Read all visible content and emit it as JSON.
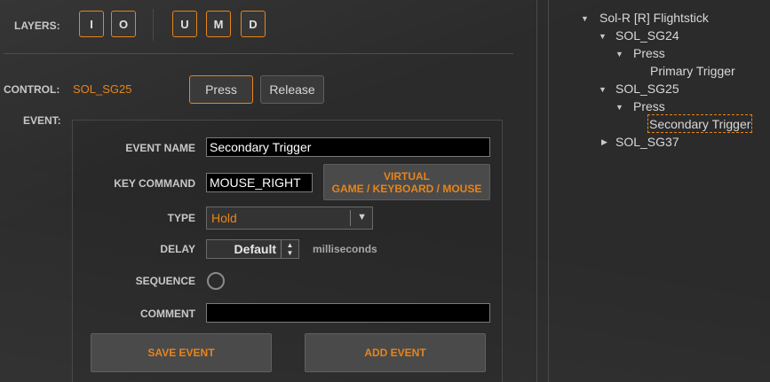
{
  "layers": {
    "label": "LAYERS:",
    "buttons": [
      "I",
      "O",
      "U",
      "M",
      "D"
    ]
  },
  "control": {
    "label": "CONTROL:",
    "value": "SOL_SG25",
    "press_label": "Press",
    "release_label": "Release"
  },
  "event": {
    "label": "EVENT:",
    "name_label": "EVENT NAME",
    "name_value": "Secondary Trigger",
    "key_label": "KEY COMMAND",
    "key_value": "MOUSE_RIGHT",
    "virtual_line1": "VIRTUAL",
    "virtual_line2": "GAME / KEYBOARD / MOUSE",
    "type_label": "TYPE",
    "type_value": "Hold",
    "delay_label": "DELAY",
    "delay_value": "Default",
    "delay_unit": "milliseconds",
    "sequence_label": "SEQUENCE",
    "comment_label": "COMMENT",
    "comment_value": "",
    "save_label": "SAVE EVENT",
    "add_label": "ADD EVENT"
  },
  "tree": {
    "root": "Sol-R [R] Flightstick",
    "items": [
      {
        "label": "SOL_SG24"
      },
      {
        "label": "Press"
      },
      {
        "label": "Primary Trigger"
      },
      {
        "label": "SOL_SG25"
      },
      {
        "label": "Press"
      },
      {
        "label": "Secondary Trigger"
      },
      {
        "label": "SOL_SG37"
      }
    ]
  },
  "colors": {
    "accent": "#e8841a",
    "background": "#2b2b2b"
  }
}
